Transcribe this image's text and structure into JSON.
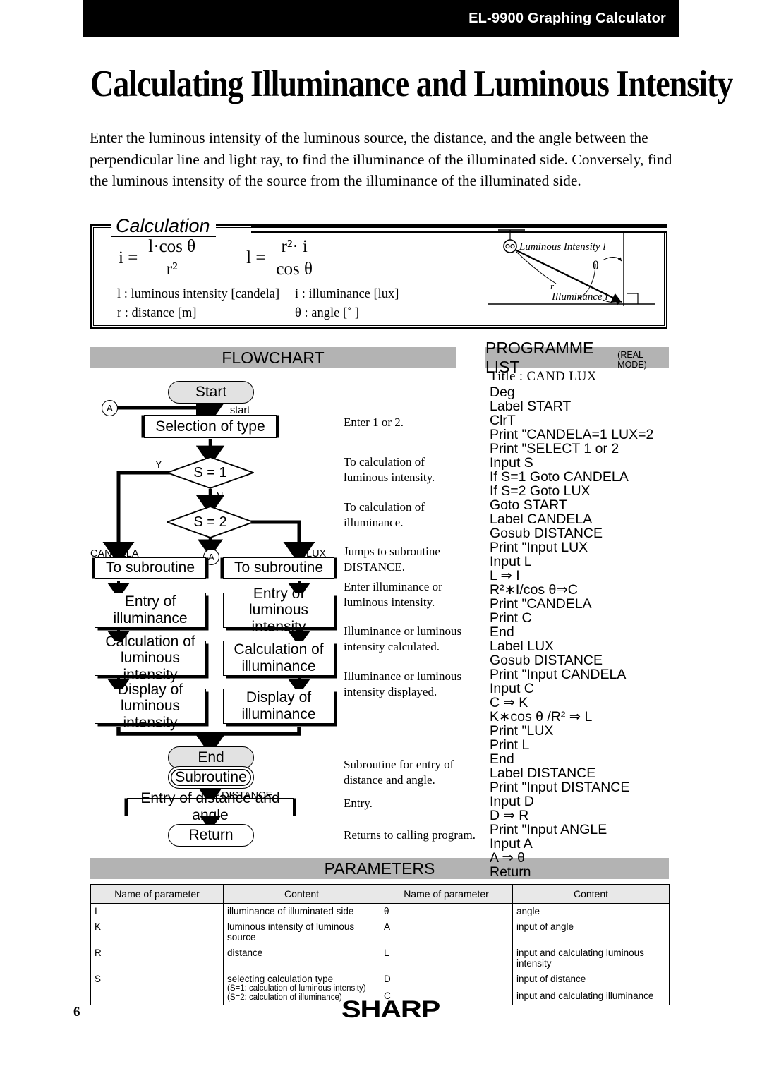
{
  "header": {
    "title": "EL-9900 Graphing Calculator"
  },
  "doc": {
    "title": "Calculating Illuminance and Luminous Intensity",
    "intro": "Enter the luminous intensity of the luminous source, the distance, and the angle between the perpendicular line and light ray, to find the illuminance of the illuminated side. Conversely, find the luminous intensity of the source from the illuminance of the illuminated side."
  },
  "calculation": {
    "legend": "Calculation",
    "formula1": {
      "lhs": "i =",
      "numerator": "l·cos θ",
      "denominator": "r²"
    },
    "formula2": {
      "lhs": "l =",
      "numerator": "r²· i",
      "denominator": "cos θ"
    },
    "keys": [
      {
        "left": "l : luminous intensity [candela]",
        "right": "i  : illuminance [lux]"
      },
      {
        "left": "r : distance [m]",
        "right": "θ : angle [˚ ]"
      }
    ],
    "diagram": {
      "lamp_label": "Luminous Intensity l",
      "angle_label": "θ",
      "distance_label": "r",
      "illuminance_label": "Illuminance i"
    }
  },
  "sections": {
    "flowchart": "FLOWCHART",
    "programme": "PROGRAMME LIST",
    "programme_note": "(REAL MODE)",
    "parameters": "PARAMETERS"
  },
  "flowchart": {
    "nodes": {
      "start": "Start",
      "selection": "Selection of type",
      "decision1": "S = 1",
      "decision2": "S = 2",
      "to_sub_left": "To subroutine",
      "to_sub_right": "To subroutine",
      "entry_left": "Entry of\nilluminance",
      "entry_left_l1": "Entry of",
      "entry_left_l2": "illuminance",
      "entry_right_l1": "Entry of",
      "entry_right_l2": "luminous intensity",
      "calc_left_l1": "Calculation of",
      "calc_left_l2": "luminous intensity",
      "calc_right_l1": "Calculation of",
      "calc_right_l2": "illuminance",
      "disp_left_l1": "Display of",
      "disp_left_l2": "luminous intensity",
      "disp_right_l1": "Display of",
      "disp_right_l2": "illuminance",
      "end": "End",
      "subroutine": "Subroutine",
      "entry_distance": "Entry of distance and angle",
      "return": "Return"
    },
    "labels": {
      "connector_a_top": "A",
      "connector_a_mid": "A",
      "start_label": "start",
      "yes": "Y",
      "no": "N",
      "candela": "CANDELA",
      "lux": "LUX",
      "distance": "DISTANCE"
    },
    "annotations": [
      "Enter 1 or 2.",
      "To calculation of\nluminous intensity.",
      "To calculation of\nilluminance.",
      "Jumps to subroutine\nDISTANCE.",
      "Enter illuminance or\nluminous intensity.",
      "Illuminance or luminous\nintensity calculated.",
      "Illuminance or luminous\nintensity displayed.",
      "Subroutine for entry of\ndistance and angle.",
      "Entry.",
      "Returns to calling program."
    ]
  },
  "programme": {
    "title": "Title : CAND LUX",
    "lines": [
      "Deg",
      "Label START",
      "ClrT",
      "Print \"CANDELA=1 LUX=2",
      "Print \"SELECT 1 or 2",
      "Input S",
      "If S=1 Goto CANDELA",
      "If S=2 Goto LUX",
      "Goto START",
      "Label CANDELA",
      "Gosub DISTANCE",
      "Print \"Input LUX",
      "Input L",
      "L ⇒ I",
      "R²∗I/cos θ⇒C",
      "Print \"CANDELA",
      "Print C",
      "End",
      "Label LUX",
      "Gosub DISTANCE",
      "Print \"Input CANDELA",
      "Input C",
      "C ⇒ K",
      "K∗cos θ /R² ⇒ L",
      "Print \"LUX",
      "Print L",
      "End",
      "Label DISTANCE",
      "Print \"Input DISTANCE",
      "Input D",
      "D ⇒ R",
      "Print \"Input ANGLE",
      "Input A",
      "A ⇒ θ",
      "Return"
    ]
  },
  "parameters": {
    "headers": [
      "Name of parameter",
      "Content",
      "Name of parameter",
      "Content"
    ],
    "rows": [
      {
        "name_l": "I",
        "content_l": "illuminance of illuminated side",
        "name_r": "θ",
        "content_r": "angle"
      },
      {
        "name_l": "K",
        "content_l": "luminous intensity of luminous source",
        "name_r": "A",
        "content_r": "input of angle"
      },
      {
        "name_l": "R",
        "content_l": "distance",
        "name_r": "L",
        "content_r": "input and calculating luminous intensity"
      },
      {
        "name_l": "S",
        "content_l": "selecting calculation type",
        "content_l_sub1": "(S=1: calculation of luminous intensity)",
        "content_l_sub2": "(S=2: calculation of illuminance)",
        "name_r": "D",
        "content_r": "input of distance"
      },
      {
        "name_r": "C",
        "content_r": "input and calculating illuminance"
      }
    ]
  },
  "footer": {
    "page_number": "6",
    "brand": "SHARP"
  }
}
